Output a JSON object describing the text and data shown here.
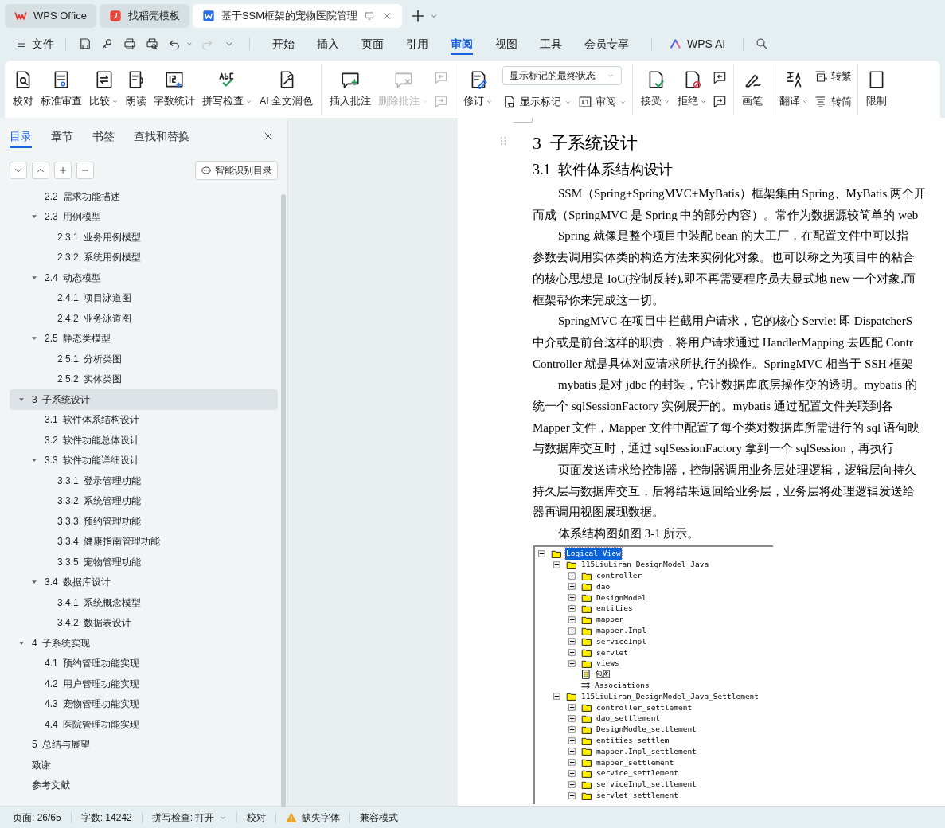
{
  "title_tabs": [
    {
      "label": "WPS Office",
      "kind": "home",
      "selected": false
    },
    {
      "label": "找稻壳模板",
      "kind": "template",
      "selected": false
    },
    {
      "label": "基于SSM框架的宠物医院管理",
      "kind": "document",
      "selected": true
    }
  ],
  "menu": {
    "file": "文件",
    "tabs": [
      {
        "label": "开始",
        "selected": false
      },
      {
        "label": "插入",
        "selected": false
      },
      {
        "label": "页面",
        "selected": false
      },
      {
        "label": "引用",
        "selected": false
      },
      {
        "label": "审阅",
        "selected": true
      },
      {
        "label": "视图",
        "selected": false
      },
      {
        "label": "工具",
        "selected": false
      },
      {
        "label": "会员专享",
        "selected": false
      }
    ],
    "ai": "WPS AI"
  },
  "ribbon": [
    {
      "kind": "tools",
      "items": [
        {
          "label": "校对",
          "menu": false
        },
        {
          "label": "标准审查",
          "menu": false
        },
        {
          "label": "比较",
          "menu": true
        },
        {
          "label": "朗读",
          "menu": false
        },
        {
          "label": "字数统计",
          "menu": false
        },
        {
          "label": "拼写检查",
          "menu": true
        },
        {
          "label": "AI 全文润色",
          "menu": false
        }
      ]
    },
    {
      "kind": "comments",
      "items": [
        {
          "label": "插入批注",
          "menu": false,
          "disabled": false
        },
        {
          "label": "删除批注",
          "menu": true,
          "disabled": true
        }
      ]
    },
    {
      "kind": "revisions",
      "revise": "修订",
      "markup_select": "显示标记的最终状态",
      "show_markup": "显示标记",
      "review_pane": "审阅"
    },
    {
      "kind": "changes",
      "items": [
        {
          "label": "接受",
          "menu": true
        },
        {
          "label": "拒绝",
          "menu": true
        }
      ]
    },
    {
      "kind": "ink",
      "label": "画笔"
    },
    {
      "kind": "language",
      "translate": "翻译",
      "to_traditional": "转繁",
      "to_simplified": "转简"
    },
    {
      "kind": "protect",
      "label": "限制"
    }
  ],
  "nav": {
    "tabs": [
      {
        "label": "目录",
        "selected": true
      },
      {
        "label": "章节",
        "selected": false
      },
      {
        "label": "书签",
        "selected": false
      },
      {
        "label": "查找和替换",
        "selected": false
      }
    ],
    "smart_button": "智能识别目录",
    "continued_items": [
      {
        "number": "2.2",
        "title": "需求功能描述",
        "selected": false
      },
      {
        "number": "2.3",
        "title": "用例模型",
        "expanded": true,
        "selected": false,
        "children": [
          {
            "number": "2.3.1",
            "title": "业务用例模型",
            "selected": false
          },
          {
            "number": "2.3.2",
            "title": "系统用例模型",
            "selected": false
          }
        ]
      },
      {
        "number": "2.4",
        "title": "动态模型",
        "expanded": true,
        "selected": false,
        "children": [
          {
            "number": "2.4.1",
            "title": "项目泳道图",
            "selected": false
          },
          {
            "number": "2.4.2",
            "title": "业务泳道图",
            "selected": false
          }
        ]
      },
      {
        "number": "2.5",
        "title": "静态类模型",
        "expanded": true,
        "selected": false,
        "children": [
          {
            "number": "2.5.1",
            "title": "分析类图",
            "selected": false
          },
          {
            "number": "2.5.2",
            "title": "实体类图",
            "selected": false
          }
        ]
      }
    ],
    "items": [
      {
        "number": "3",
        "title": "子系统设计",
        "expanded": true,
        "selected": true,
        "children": [
          {
            "number": "3.1",
            "title": "软件体系结构设计",
            "selected": false
          },
          {
            "number": "3.2",
            "title": "软件功能总体设计",
            "selected": false
          },
          {
            "number": "3.3",
            "title": "软件功能详细设计",
            "expanded": true,
            "selected": false,
            "children": [
              {
                "number": "3.3.1",
                "title": "登录管理功能",
                "selected": false
              },
              {
                "number": "3.3.2",
                "title": "系统管理功能",
                "selected": false
              },
              {
                "number": "3.3.3",
                "title": "预约管理功能",
                "selected": false
              },
              {
                "number": "3.3.4",
                "title": "健康指南管理功能",
                "selected": false
              },
              {
                "number": "3.3.5",
                "title": "宠物管理功能",
                "selected": false
              }
            ]
          },
          {
            "number": "3.4",
            "title": "数据库设计",
            "expanded": true,
            "selected": false,
            "children": [
              {
                "number": "3.4.1",
                "title": "系统概念模型",
                "selected": false
              },
              {
                "number": "3.4.2",
                "title": "数据表设计",
                "selected": false
              }
            ]
          }
        ]
      },
      {
        "number": "4",
        "title": "子系统实现",
        "expanded": true,
        "selected": false,
        "children": [
          {
            "number": "4.1",
            "title": "预约管理功能实现",
            "selected": false
          },
          {
            "number": "4.2",
            "title": "用户管理功能实现",
            "selected": false
          },
          {
            "number": "4.3",
            "title": "宠物管理功能实现",
            "selected": false
          },
          {
            "number": "4.4",
            "title": "医院管理功能实现",
            "selected": false
          }
        ]
      },
      {
        "number": "5",
        "title": "总结与展望",
        "selected": false
      },
      {
        "title": "致谢",
        "selected": false
      },
      {
        "title": "参考文献",
        "selected": false
      }
    ]
  },
  "document": {
    "heading_1": {
      "number": "3",
      "title": "子系统设计"
    },
    "heading_2": {
      "number": "3.1",
      "title": "软件体系结构设计"
    },
    "paragraphs": [
      [
        "SSM（Spring+SpringMVC+MyBatis）框架集由 Spring、MyBatis 两个开",
        "而成（SpringMVC 是 Spring 中的部分内容）。常作为数据源较简单的 web"
      ],
      [
        "Spring 就像是整个项目中装配 bean 的大工厂，在配置文件中可以指",
        "参数去调用实体类的构造方法来实例化对象。也可以称之为项目中的粘合",
        "的核心思想是 IoC(控制反转),即不再需要程序员去显式地 new 一个对象,而",
        "框架帮你来完成这一切。"
      ],
      [
        "SpringMVC 在项目中拦截用户请求，它的核心 Servlet 即 DispatcherS",
        "中介或是前台这样的职责，将用户请求通过 HandlerMapping 去匹配 Contr",
        "Controller 就是具体对应请求所执行的操作。SpringMVC 相当于 SSH 框架"
      ],
      [
        "mybatis 是对 jdbc 的封装，它让数据库底层操作变的透明。mybatis 的",
        "统一个 sqlSessionFactory 实例展开的。mybatis 通过配置文件关联到各",
        "Mapper 文件，Mapper 文件中配置了每个类对数据库所需进行的 sql 语句映",
        "与数据库交互时，通过 sqlSessionFactory 拿到一个 sqlSession，再执行"
      ],
      [
        "页面发送请求给控制器，控制器调用业务层处理逻辑，逻辑层向持久",
        "持久层与数据库交互，后将结果返回给业务层，业务层将处理逻辑发送给",
        "器再调用视图展现数据。"
      ],
      [
        "体系结构图如图 3-1 所示。"
      ]
    ],
    "figure_tree": [
      {
        "label": "Logical View",
        "kind": "folder",
        "expanded": true,
        "selected": true,
        "children": [
          {
            "label": "115LiuLiran_DesignModel_Java",
            "kind": "folder",
            "expanded": true,
            "selected": false,
            "children": [
              {
                "label": "controller",
                "kind": "folder",
                "expanded": false,
                "selected": false
              },
              {
                "label": "dao",
                "kind": "folder",
                "expanded": false,
                "selected": false
              },
              {
                "label": "DesignModel",
                "kind": "folder",
                "expanded": false,
                "selected": false
              },
              {
                "label": "entities",
                "kind": "folder",
                "expanded": false,
                "selected": false
              },
              {
                "label": "mapper",
                "kind": "folder",
                "expanded": false,
                "selected": false
              },
              {
                "label": "mapper.Impl",
                "kind": "folder",
                "expanded": false,
                "selected": false
              },
              {
                "label": "serviceImpl",
                "kind": "folder",
                "expanded": false,
                "selected": false
              },
              {
                "label": "servlet",
                "kind": "folder",
                "expanded": false,
                "selected": false
              },
              {
                "label": "views",
                "kind": "folder",
                "expanded": false,
                "selected": false
              },
              {
                "label": "包图",
                "kind": "diagram",
                "selected": false
              },
              {
                "label": "Associations",
                "kind": "associations",
                "selected": false
              }
            ]
          },
          {
            "label": "115LiuLiran_DesignModel_Java_Settlement",
            "kind": "folder",
            "expanded": true,
            "selected": false,
            "children": [
              {
                "label": "controller_settlement",
                "kind": "folder",
                "expanded": false,
                "selected": false
              },
              {
                "label": "dao_settlement",
                "kind": "folder",
                "expanded": false,
                "selected": false
              },
              {
                "label": "DesignModle_settlement",
                "kind": "folder",
                "expanded": false,
                "selected": false
              },
              {
                "label": "entities_settlem",
                "kind": "folder",
                "expanded": false,
                "selected": false
              },
              {
                "label": "mapper.Impl_settlement",
                "kind": "folder",
                "expanded": false,
                "selected": false
              },
              {
                "label": "mapper_settlement",
                "kind": "folder",
                "expanded": false,
                "selected": false
              },
              {
                "label": "service_settlement",
                "kind": "folder",
                "expanded": false,
                "selected": false
              },
              {
                "label": "serviceImpl_settlement",
                "kind": "folder",
                "expanded": false,
                "selected": false
              },
              {
                "label": "servlet_settlement",
                "kind": "folder",
                "expanded": false,
                "selected": false
              }
            ]
          }
        ]
      }
    ]
  },
  "status_bar": {
    "page": "页面: 26/65",
    "words": "字数: 14242",
    "spell_check": "拼写检查: 打开",
    "proofread": "校对",
    "missing_fonts": "缺失字体",
    "mode": "兼容模式"
  }
}
